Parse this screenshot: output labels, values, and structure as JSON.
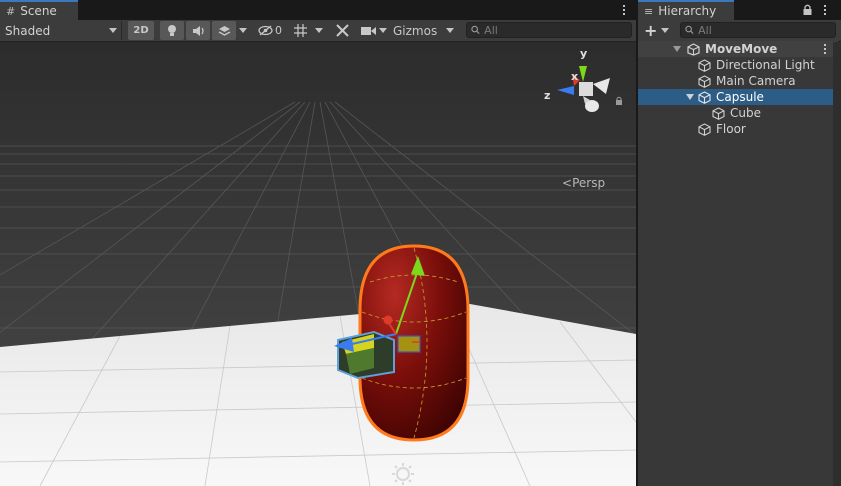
{
  "scene_tab": {
    "title": "Scene",
    "icon": "grid-icon"
  },
  "scene_toolbar": {
    "draw_mode": "Shaded",
    "mode_2d": "2D",
    "hidden_count": "0",
    "gizmos_label": "Gizmos",
    "search_placeholder": "All"
  },
  "viewport": {
    "projection_label": "Persp",
    "axis_labels": {
      "y": "y",
      "x": "x",
      "z": "z"
    }
  },
  "hierarchy_tab": {
    "title": "Hierarchy",
    "icon": "list-icon"
  },
  "hierarchy_toolbar": {
    "add_label": "+",
    "search_placeholder": "All"
  },
  "hierarchy": {
    "scene_name": "MoveMove",
    "items": [
      {
        "label": "Directional Light",
        "depth": 1,
        "selected": false
      },
      {
        "label": "Main Camera",
        "depth": 1,
        "selected": false
      },
      {
        "label": "Capsule",
        "depth": 1,
        "selected": true,
        "expanded": true
      },
      {
        "label": "Cube",
        "depth": 2,
        "selected": false
      },
      {
        "label": "Floor",
        "depth": 1,
        "selected": false
      }
    ]
  },
  "colors": {
    "selection": "#2c5d87",
    "tab_accent": "#3a79bb",
    "capsule_outline": "#ff7a1a",
    "axis_y": "#7cd81c",
    "axis_x": "#e03a2a",
    "axis_z": "#3a7cf0"
  }
}
